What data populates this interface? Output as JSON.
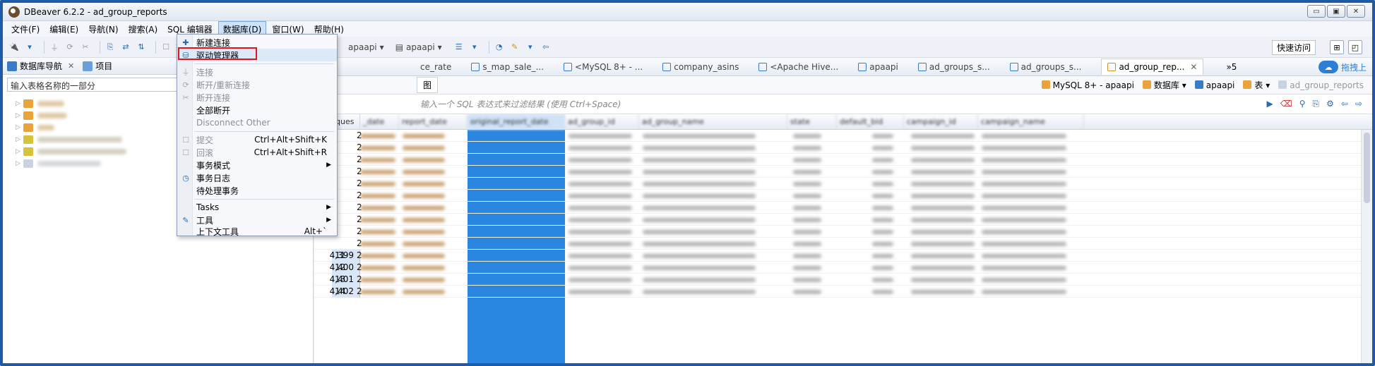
{
  "window": {
    "title": "DBeaver 6.2.2 - ad_group_reports",
    "min": "▭",
    "max": "▣",
    "close": "✕"
  },
  "menubar": [
    "文件(F)",
    "编辑(E)",
    "导航(N)",
    "搜索(A)",
    "SQL 编辑器",
    "数据库(D)",
    "窗口(W)",
    "帮助(H)"
  ],
  "toolbar": {
    "commit_label": "提交",
    "combo1": "apaapi",
    "combo2": "apaapi",
    "quick_access": "快速访问"
  },
  "left_panel": {
    "tab_navigator": "数据库导航",
    "tab_projects": "项目",
    "filter_placeholder": "输入表格名称的一部分",
    "tree_items": 6
  },
  "editor": {
    "tabs": [
      "ce_rate",
      "s_map_sale_...",
      "<MySQL 8+ - ...",
      "company_asins",
      "<Apache Hive...",
      "apaapi",
      "ad_groups_s...",
      "ad_groups_s...",
      "ad_group_rep..."
    ],
    "more": "»5",
    "right_badge": "拖拽上",
    "ctx_tab": "图",
    "ctx_connection": "MySQL 8+ - apaapi",
    "ctx_database_label": "数据库",
    "ctx_schema": "apaapi",
    "ctx_table_label": "表",
    "ctx_table": "ad_group_reports",
    "filter_placeholder": "输入一个 SQL 表达式来过滤结果 (使用 Ctrl+Space)"
  },
  "grid": {
    "columns": [
      "reques",
      "_date",
      "report_date",
      "original_report_date",
      "ad_group_id",
      "ad_group_name",
      "state",
      "default_bid",
      "campaign_id",
      "campaign_name"
    ],
    "visible_rows": [
      {
        "num": "11",
        "id": "4,399",
        "v": "2"
      },
      {
        "num": "12",
        "id": "4,400",
        "v": "2"
      },
      {
        "num": "13",
        "id": "4,401",
        "v": "2"
      },
      {
        "num": "14",
        "id": "4,402",
        "v": "2"
      }
    ],
    "hidden_rows_v": [
      "2",
      "2",
      "2",
      "2",
      "2",
      "2",
      "2",
      "2",
      "2",
      "2"
    ]
  },
  "dropdown": {
    "items": [
      {
        "label": "新建连接",
        "disabled": false
      },
      {
        "label": "驱动管理器",
        "disabled": false
      },
      {
        "label": "连接",
        "disabled": true
      },
      {
        "label": "断开/重新连接",
        "disabled": true
      },
      {
        "label": "断开连接",
        "disabled": true
      },
      {
        "label": "全部断开",
        "disabled": false
      },
      {
        "label": "Disconnect Other",
        "disabled": true
      },
      {
        "label": "提交",
        "disabled": true,
        "shortcut": "Ctrl+Alt+Shift+K"
      },
      {
        "label": "回滚",
        "disabled": true,
        "shortcut": "Ctrl+Alt+Shift+R"
      },
      {
        "label": "事务模式",
        "disabled": false
      },
      {
        "label": "事务日志",
        "disabled": false
      },
      {
        "label": "待处理事务",
        "disabled": false
      },
      {
        "label": "Tasks",
        "disabled": false
      },
      {
        "label": "工具",
        "disabled": false
      },
      {
        "label": "上下文工具",
        "disabled": false,
        "shortcut": "Alt+`"
      }
    ]
  }
}
